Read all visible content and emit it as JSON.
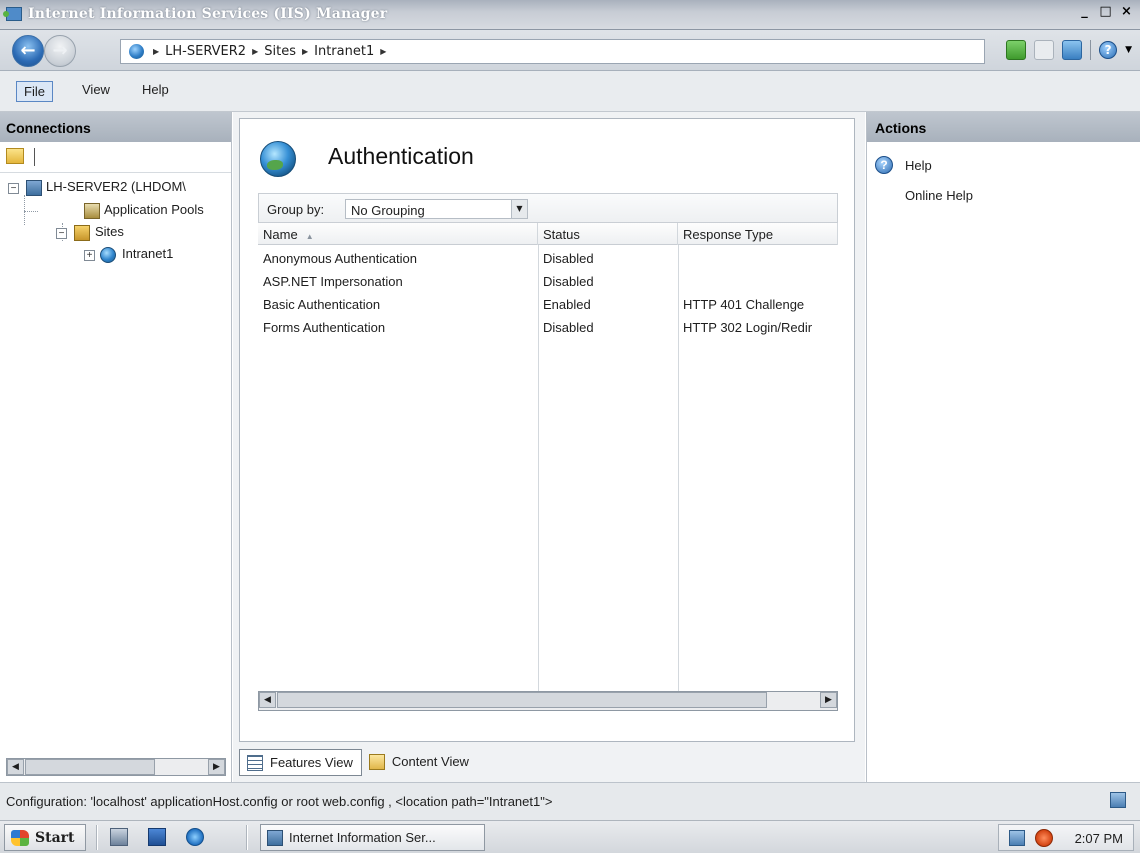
{
  "window": {
    "title": "Internet Information Services (IIS) Manager",
    "controls": {
      "minimize": "_",
      "maximize": "□",
      "close": "×"
    }
  },
  "address": {
    "crumbs": [
      "LH-SERVER2",
      "Sites",
      "Intranet1"
    ]
  },
  "menu": {
    "file": "File",
    "view": "View",
    "help": "Help"
  },
  "connections": {
    "title": "Connections",
    "tree": {
      "server": "LH-SERVER2 (LHDOM\\",
      "app_pools": "Application Pools",
      "sites": "Sites",
      "site": "Intranet1"
    }
  },
  "page": {
    "title": "Authentication",
    "group_by_label": "Group by:",
    "group_by_value": "No Grouping",
    "columns": {
      "name": "Name",
      "status": "Status",
      "response": "Response Type"
    },
    "rows": [
      {
        "name": "Anonymous Authentication",
        "status": "Disabled",
        "response": ""
      },
      {
        "name": "ASP.NET Impersonation",
        "status": "Disabled",
        "response": ""
      },
      {
        "name": "Basic Authentication",
        "status": "Enabled",
        "response": "HTTP 401 Challenge"
      },
      {
        "name": "Forms Authentication",
        "status": "Disabled",
        "response": "HTTP 302 Login/Redir"
      }
    ],
    "tabs": {
      "features": "Features View",
      "content": "Content View"
    }
  },
  "actions": {
    "title": "Actions",
    "help": "Help",
    "online_help": "Online Help"
  },
  "status": {
    "text": "Configuration: 'localhost' applicationHost.config or root web.config , <location path=\"Intranet1\">"
  },
  "taskbar": {
    "start": "Start",
    "task": "Internet Information Ser...",
    "clock": "2:07 PM"
  },
  "colors": {
    "title_gradient_top": "#a9b1bd",
    "panel_header": "#bfc6cf",
    "accent_blue": "#2c6bb5"
  }
}
